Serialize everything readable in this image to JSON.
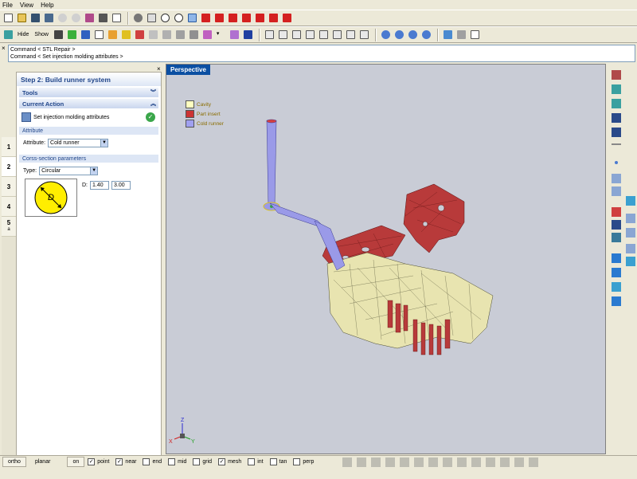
{
  "menu": [
    "File",
    "View",
    "Help"
  ],
  "toolbar2": {
    "hide_label": "Hide",
    "show_label": "Show"
  },
  "command": {
    "close_glyph": "×",
    "lines": [
      "Command < STL Repair >",
      "Command < Set injection molding attributes >"
    ]
  },
  "left_panel": {
    "close_glyph": "×",
    "title": "Step 2: Build runner system",
    "tools_header": "Tools",
    "current_action_header": "Current Action",
    "action_label": "Set injection molding attributes",
    "action_icon": "injection-icon",
    "attribute_group": "Attribute",
    "attribute_label": "Attribute:",
    "attribute_value": "Cold runner",
    "cross_section_group": "Corss-section parameters",
    "type_label": "Type:",
    "type_value": "Circular",
    "d_label": "D:",
    "d_value_1": "1.40",
    "d_value_2": "3.00",
    "diagram_letter": "D",
    "steps": [
      "1",
      "2",
      "3",
      "4",
      "5"
    ],
    "step_extra": "a"
  },
  "viewport": {
    "title": "Perspective",
    "legend": [
      {
        "label": "Cavity",
        "color": "#ffffc0"
      },
      {
        "label": "Part insert",
        "color": "#cc3333"
      },
      {
        "label": "Cold runner",
        "color": "#a0a0f0"
      }
    ],
    "axis_z": "Z",
    "axis_x": "X",
    "axis_y": "Y"
  },
  "statusbar": {
    "ortho": "ortho",
    "planar": "planar",
    "on": "on",
    "snaps": [
      {
        "label": "point",
        "checked": true
      },
      {
        "label": "near",
        "checked": true
      },
      {
        "label": "end",
        "checked": false
      },
      {
        "label": "mid",
        "checked": false
      },
      {
        "label": "grid",
        "checked": false
      },
      {
        "label": "mesh",
        "checked": true
      },
      {
        "label": "int",
        "checked": false
      },
      {
        "label": "tan",
        "checked": false
      },
      {
        "label": "perp",
        "checked": false
      }
    ]
  },
  "colors": {
    "accent": "#0b4fa2",
    "cavity": "#e8e4b0",
    "insert": "#b83a3a",
    "runner": "#9a9ae8"
  }
}
